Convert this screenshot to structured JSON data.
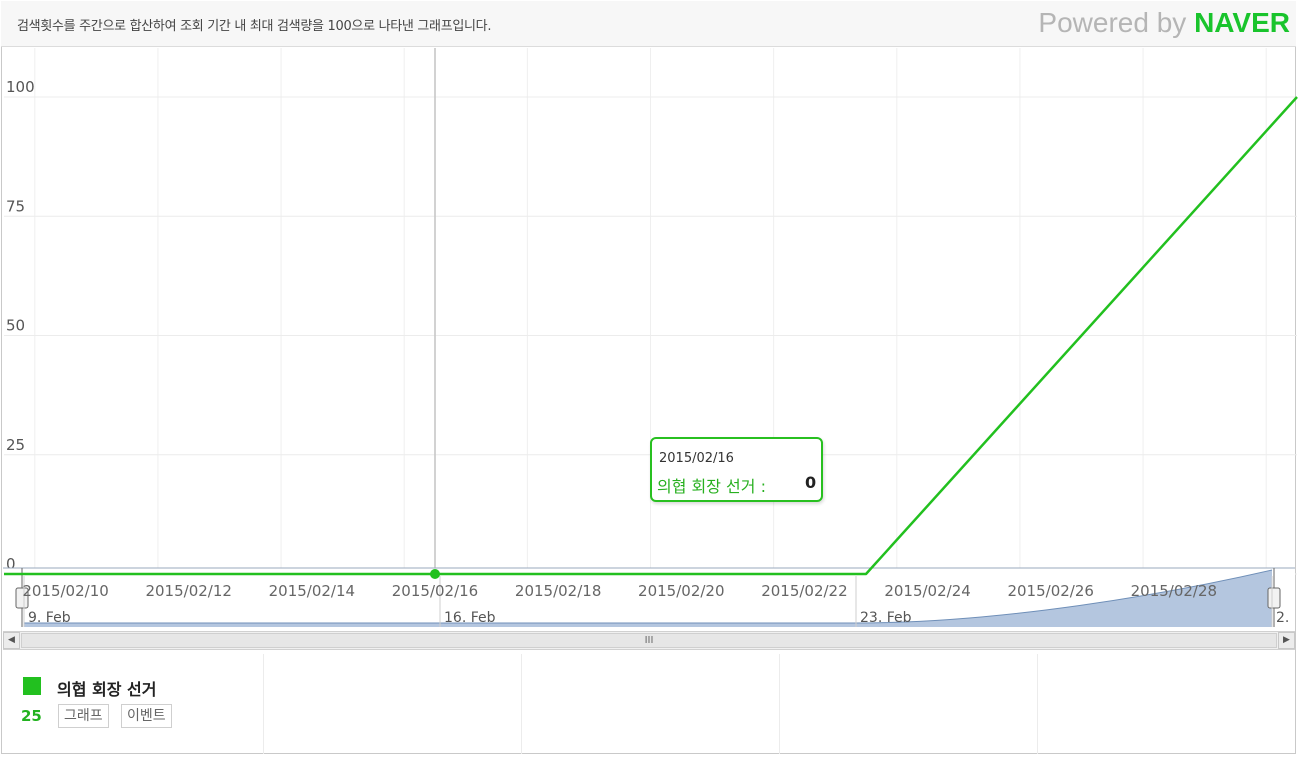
{
  "header": {
    "description": "검색횟수를 주간으로 합산하여 조회 기간 내 최대 검색량을 100으로 나타낸 그래프입니다.",
    "powered_by": "Powered by",
    "brand": "NAVER"
  },
  "colors": {
    "series": "#22c01f",
    "navigator_fill": "#b4c6df",
    "navigator_stroke": "#6f8fb8"
  },
  "chart_data": {
    "type": "line",
    "x_axis_type": "date",
    "xlim": [
      "2015-02-09",
      "2015-03-02"
    ],
    "ylim": [
      0,
      110
    ],
    "y_ticks": [
      0,
      25,
      50,
      75,
      100
    ],
    "x_ticks": [
      "2015/02/10",
      "2015/02/12",
      "2015/02/14",
      "2015/02/16",
      "2015/02/18",
      "2015/02/20",
      "2015/02/22",
      "2015/02/24",
      "2015/02/26",
      "2015/02/28"
    ],
    "grid": true,
    "series": [
      {
        "name": "의협 회장 선거",
        "points": [
          {
            "x": "2015-02-09",
            "y": 0
          },
          {
            "x": "2015-02-16",
            "y": 0
          },
          {
            "x": "2015-02-23",
            "y": 0
          },
          {
            "x": "2015-03-02",
            "y": 100
          }
        ]
      }
    ],
    "navigator": {
      "labels": [
        "9. Feb",
        "16. Feb",
        "23. Feb",
        "2."
      ]
    },
    "tooltip": {
      "date": "2015/02/16",
      "series": "의협 회장 선거",
      "separator": " : ",
      "value": "0"
    },
    "crosshair_x": "2015-02-16"
  },
  "scrollbar": {
    "left_arrow": "◀",
    "right_arrow": "▶",
    "thumb_grip": "III"
  },
  "legend": {
    "keyword": "의협 회장 선거",
    "value": "25",
    "graph_button": "그래프",
    "event_button": "이벤트"
  }
}
